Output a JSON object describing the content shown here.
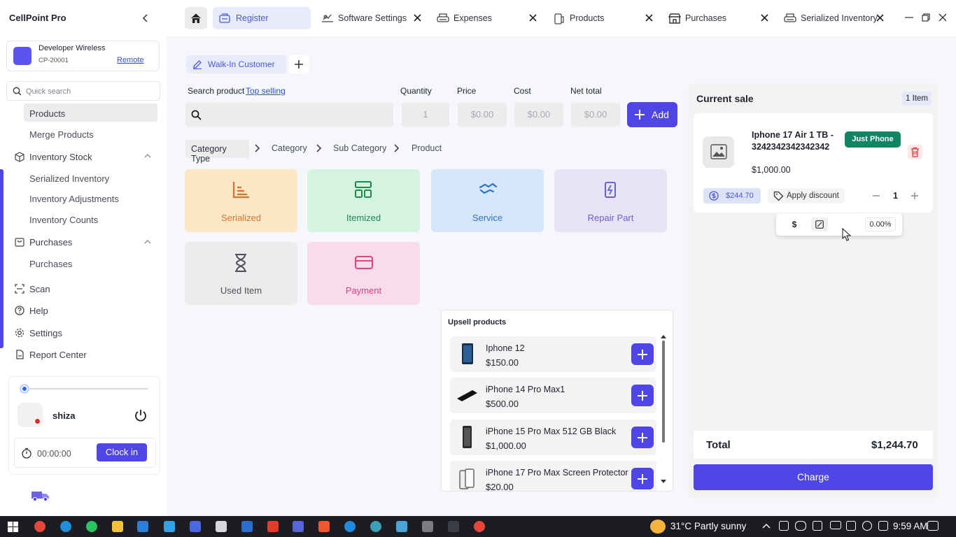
{
  "app": {
    "title": "CellPoint Pro"
  },
  "device": {
    "name": "Developer Wireless",
    "id": "CP-20001",
    "mode_link": "Remote"
  },
  "search": {
    "placeholder": "Quick search"
  },
  "sidebar": {
    "items": [
      {
        "label": "Products",
        "active": true
      },
      {
        "label": "Merge Products"
      },
      {
        "label": "Inventory Stock",
        "icon": "box-icon",
        "expanded": true
      },
      {
        "label": "Serialized Inventory"
      },
      {
        "label": "Inventory Adjustments"
      },
      {
        "label": "Inventory Counts"
      },
      {
        "label": "Purchases",
        "icon": "cart-icon",
        "expanded": true
      },
      {
        "label": "Purchases"
      },
      {
        "label": "Scan",
        "icon": "scan-icon"
      },
      {
        "label": "Help",
        "icon": "help-icon"
      },
      {
        "label": "Settings",
        "icon": "gear-icon"
      },
      {
        "label": "Report Center",
        "icon": "report-icon"
      }
    ]
  },
  "user": {
    "name": "shiza",
    "status_color": "#e02a2a",
    "timer": "00:00:00",
    "clock_in_label": "Clock in"
  },
  "tabs": [
    {
      "label": "Register",
      "icon": "register-icon",
      "active": true
    },
    {
      "label": "Software Settings",
      "icon": "settings-icon"
    },
    {
      "label": "Expenses",
      "icon": "printer-icon"
    },
    {
      "label": "Products",
      "icon": "phone-icon"
    },
    {
      "label": "Purchases",
      "icon": "store-icon"
    },
    {
      "label": "Serialized Inventory",
      "icon": "printer-icon"
    }
  ],
  "register": {
    "customer": "Walk-In Customer",
    "labels": {
      "search_product": "Search product",
      "top_selling": "Top selling",
      "quantity": "Quantity",
      "price": "Price",
      "cost": "Cost",
      "net_total": "Net total"
    },
    "quantity_placeholder": "1",
    "price_placeholder": "$0.00",
    "cost_placeholder": "$0.00",
    "net_total_placeholder": "$0.00",
    "add_label": "Add",
    "breadcrumb": [
      "Category Type",
      "Category",
      "Sub Category",
      "Product"
    ],
    "tiles": [
      {
        "label": "Serialized",
        "icon": "bar-chart-icon",
        "bg": "#fde7c6",
        "color": "#d9742b"
      },
      {
        "label": "Itemized",
        "icon": "layout-icon",
        "bg": "#d5f3e1",
        "color": "#1f8a4c"
      },
      {
        "label": "Service",
        "icon": "handshake-icon",
        "bg": "#d6e6fb",
        "color": "#2f73c9"
      },
      {
        "label": "Repair Part",
        "icon": "battery-icon",
        "bg": "#e8e4f8",
        "color": "#6a5fd0"
      },
      {
        "label": "Used Item",
        "icon": "hourglass-icon",
        "bg": "#ececec",
        "color": "#4a4f5b"
      },
      {
        "label": "Payment",
        "icon": "card-icon",
        "bg": "#f9dbe9",
        "color": "#e0417e"
      }
    ]
  },
  "upsell": {
    "title": "Upsell products",
    "items": [
      {
        "name": "Iphone 12",
        "price": "$150.00"
      },
      {
        "name": "iPhone 14 Pro Max1",
        "price": "$500.00"
      },
      {
        "name": "iPhone 15 Pro Max 512 GB Black",
        "price": "$1,000.00"
      },
      {
        "name": "iPhone 17 Pro Max Screen Protector",
        "price": "$20.00"
      }
    ]
  },
  "sale": {
    "title": "Current sale",
    "count": "1 Item",
    "item": {
      "name": "Iphone 17 Air 1 TB - 3242342342342342",
      "tag": "Just Phone",
      "price": "$1,000.00",
      "tax": "$244.70",
      "discount_label": "Apply discount",
      "qty": "1"
    },
    "discount_popup": {
      "dollar": "$",
      "percent_value": "0.00%"
    },
    "total_label": "Total",
    "total": "$1,244.70",
    "charge_label": "Charge"
  },
  "taskbar": {
    "weather": "31°C  Partly sunny",
    "time": "9:59 AM"
  }
}
